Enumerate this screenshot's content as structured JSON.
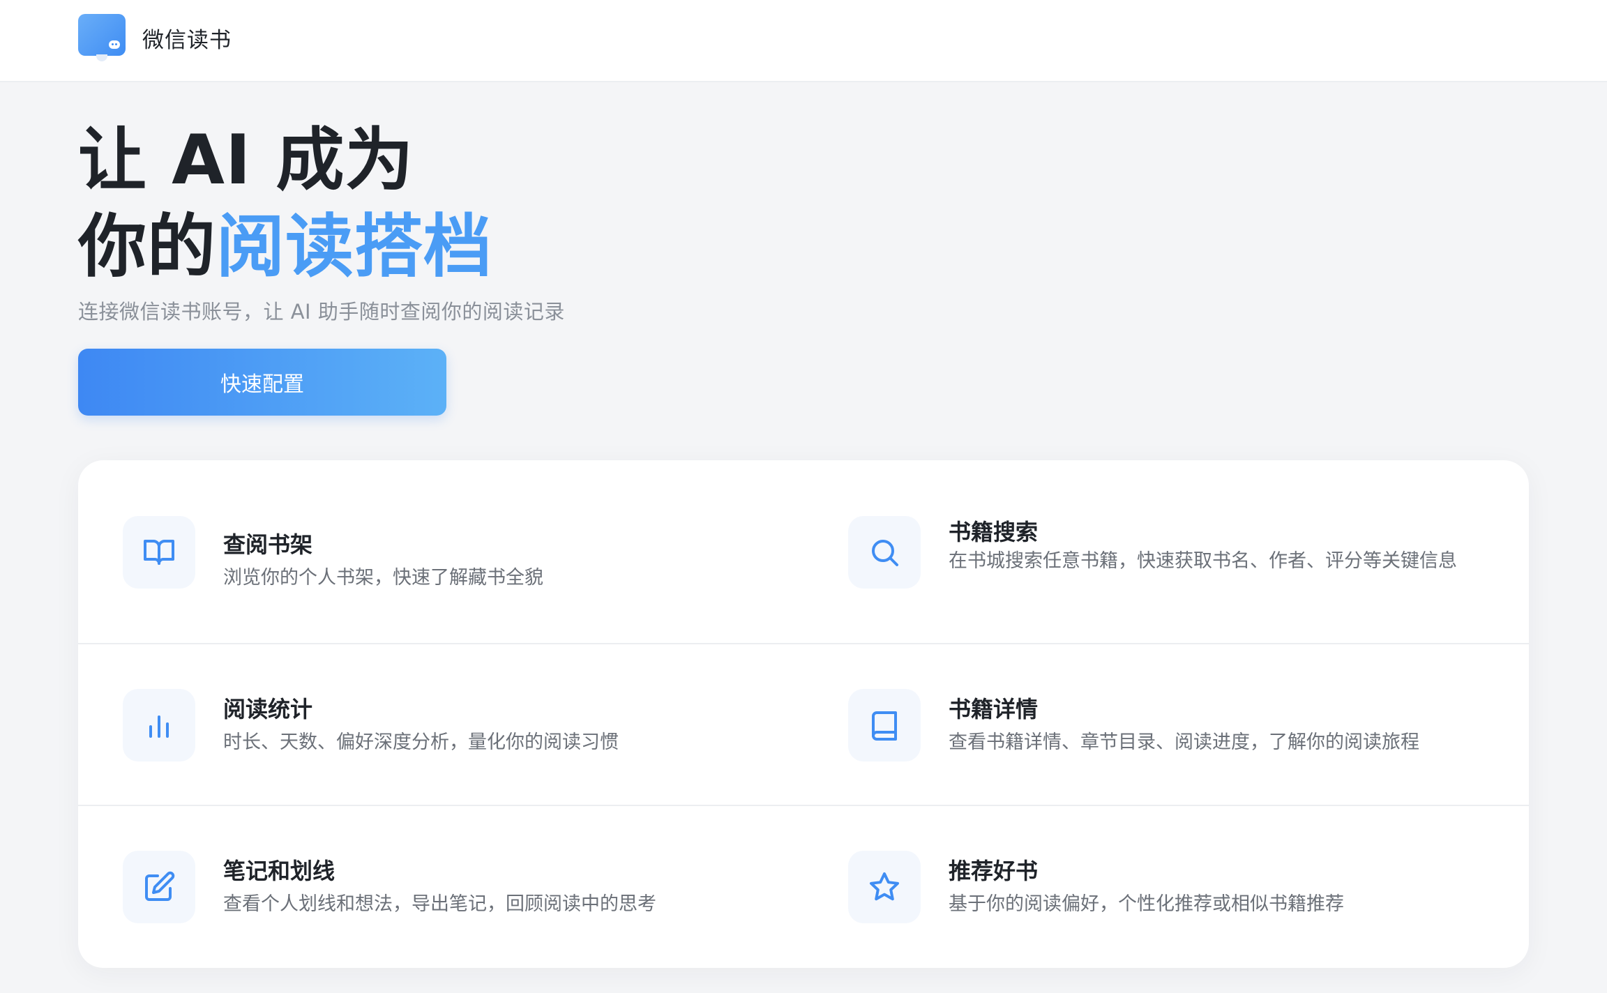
{
  "header": {
    "brand": "微信读书"
  },
  "hero": {
    "title_line1": "让 AI 成为",
    "title_line2_prefix": "你的",
    "title_line2_accent": "阅读搭档",
    "subtitle": "连接微信读书账号，让 AI 助手随时查阅你的阅读记录",
    "cta_label": "快速配置"
  },
  "features": [
    {
      "icon": "open-book-icon",
      "title": "查阅书架",
      "desc": "浏览你的个人书架，快速了解藏书全貌"
    },
    {
      "icon": "search-icon",
      "title": "书籍搜索",
      "desc": "在书城搜索任意书籍，快速获取书名、作者、评分等关键信息"
    },
    {
      "icon": "bar-chart-icon",
      "title": "阅读统计",
      "desc": "时长、天数、偏好深度分析，量化你的阅读习惯"
    },
    {
      "icon": "book-icon",
      "title": "书籍详情",
      "desc": "查看书籍详情、章节目录、阅读进度，了解你的阅读旅程"
    },
    {
      "icon": "edit-icon",
      "title": "笔记和划线",
      "desc": "查看个人划线和想法，导出笔记，回顾阅读中的思考"
    },
    {
      "icon": "star-icon",
      "title": "推荐好书",
      "desc": "基于你的阅读偏好，个性化推荐或相似书籍推荐"
    }
  ],
  "colors": {
    "accent": "#4a9cf5",
    "cta_start": "#3e88f3",
    "cta_end": "#5cb1f7",
    "icon": "#3f8df3"
  }
}
